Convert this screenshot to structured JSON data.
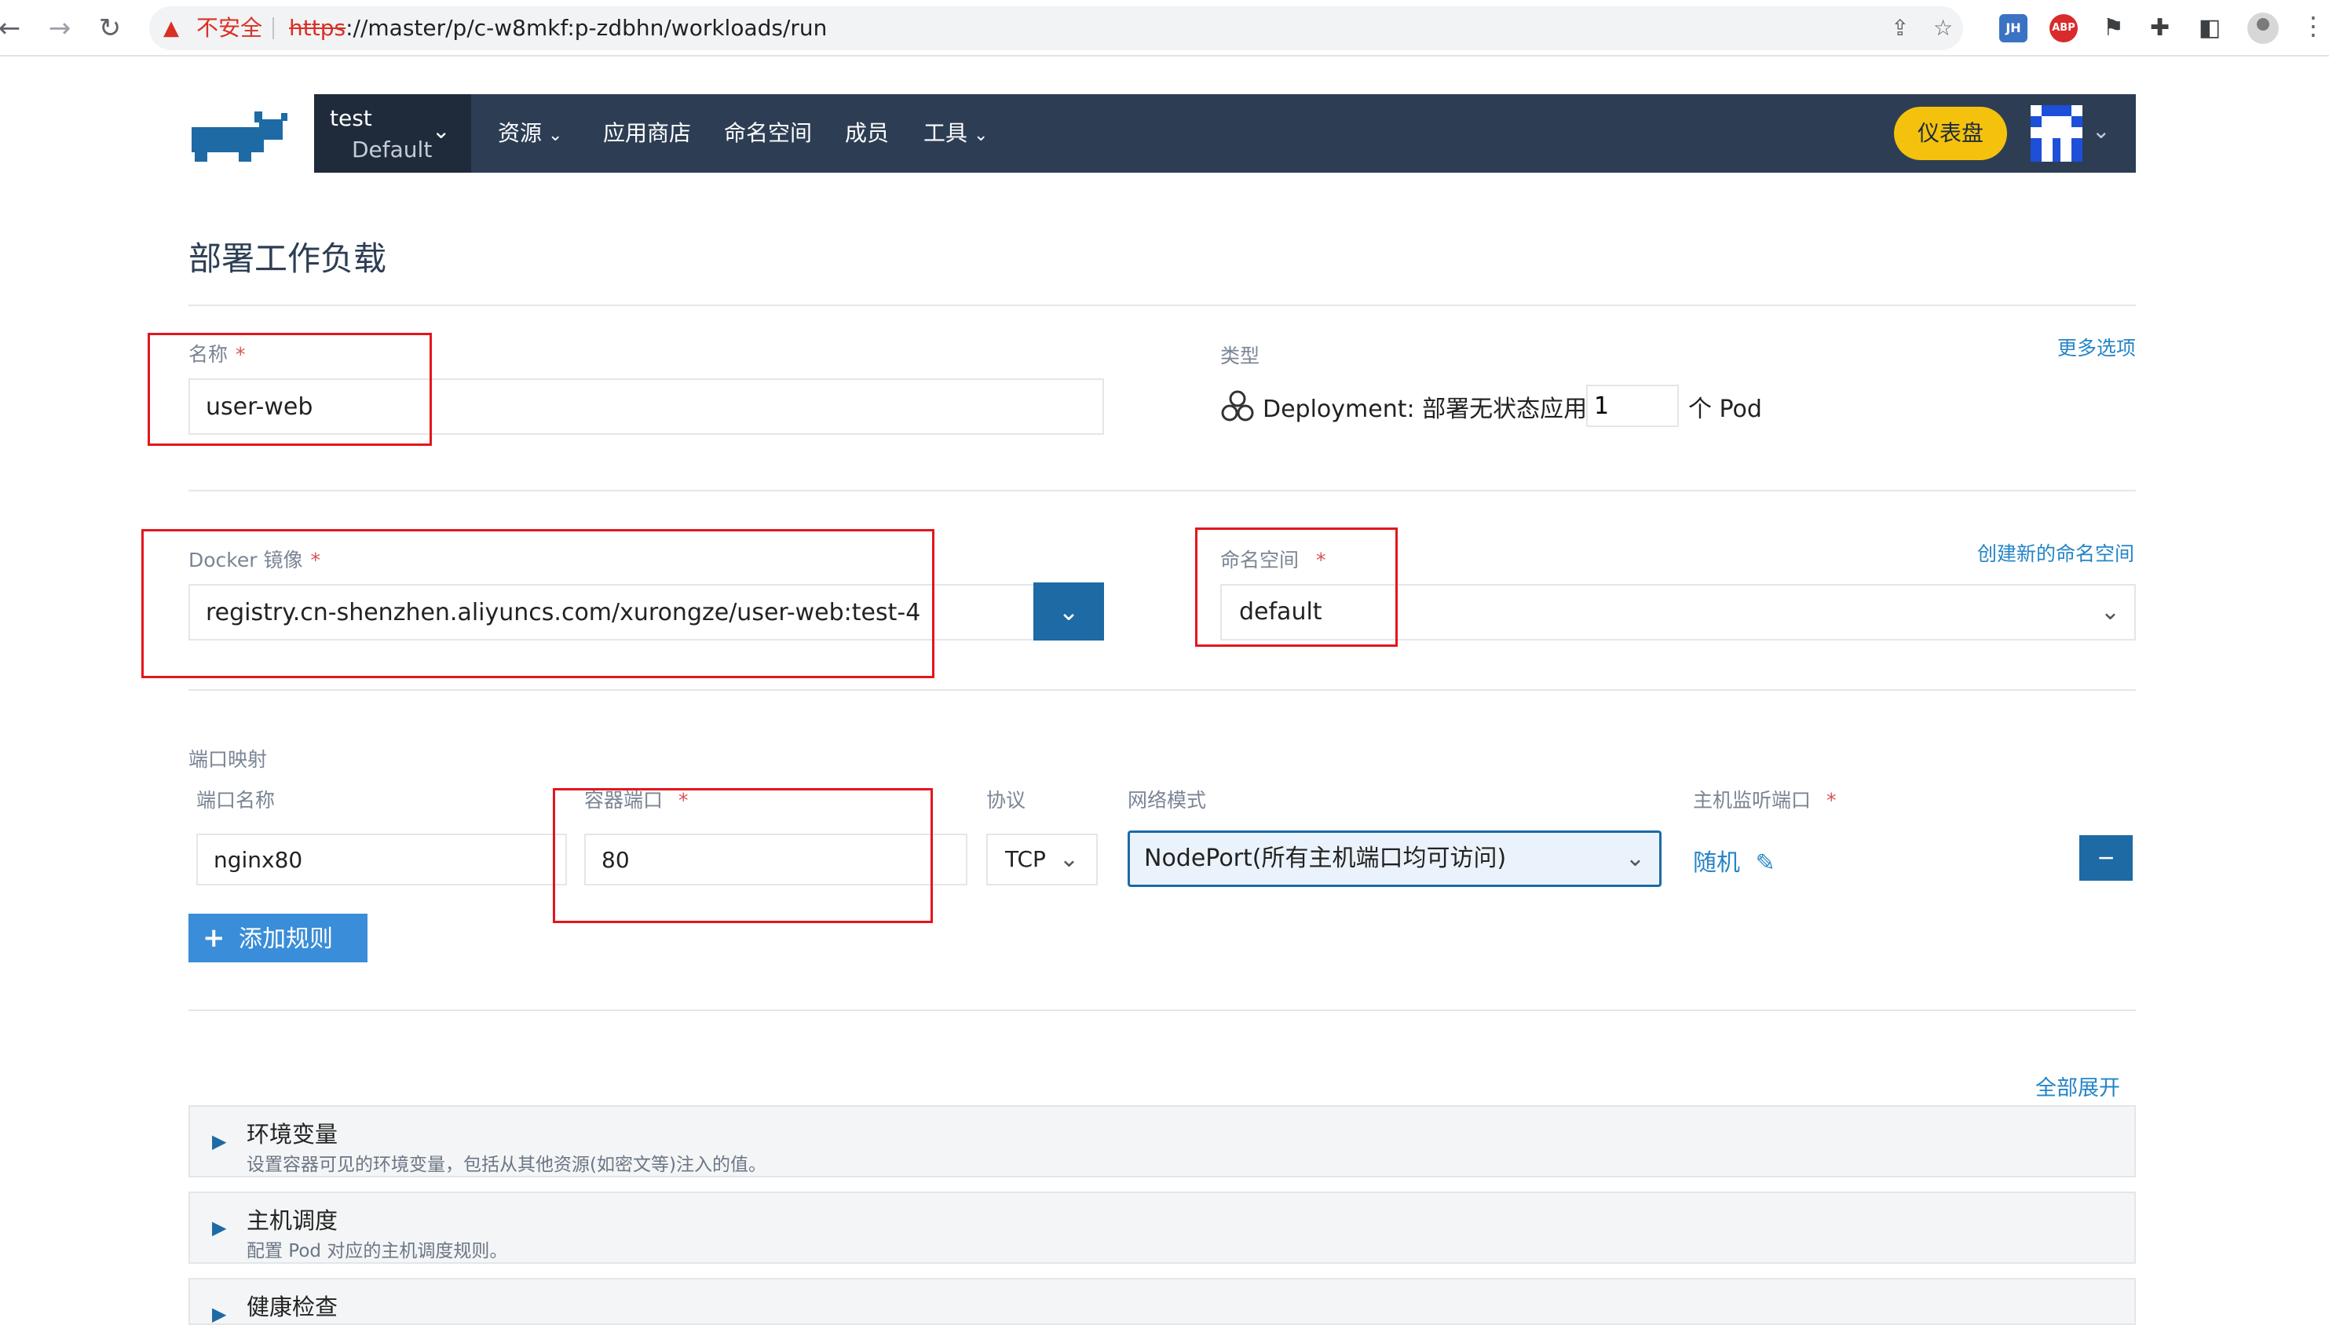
{
  "browser": {
    "insecure_label": "不安全",
    "url_scheme": "https",
    "url_rest": "://master/p/c-w8mkf:p-zdbhn/workloads/run",
    "ext_jh": "JH",
    "ext_abp": "ABP"
  },
  "header": {
    "cluster": "test",
    "project": "Default",
    "nav": {
      "resources": "资源",
      "app_store": "应用商店",
      "namespaces": "命名空间",
      "members": "成员",
      "tools": "工具"
    },
    "dashboard_btn": "仪表盘"
  },
  "page": {
    "title": "部署工作负载"
  },
  "form": {
    "name_label": "名称",
    "required_mark": "*",
    "name_value": "user-web",
    "type_label": "类型",
    "more_options": "更多选项",
    "workload_type": "Deployment: 部署无状态应用",
    "scale": "1",
    "pod_suffix": "个 Pod",
    "image_label": "Docker 镜像",
    "image_value": "registry.cn-shenzhen.aliyuncs.com/xurongze/user-web:test-4",
    "namespace_label": "命名空间",
    "create_namespace": "创建新的命名空间",
    "namespace_value": "default"
  },
  "ports": {
    "section_label": "端口映射",
    "col_name": "端口名称",
    "col_container_port": "容器端口",
    "col_protocol": "协议",
    "col_network_mode": "网络模式",
    "col_host_port": "主机监听端口",
    "rows": [
      {
        "name": "nginx80",
        "container_port": "80",
        "protocol": "TCP",
        "network_mode": "NodePort(所有主机端口均可访问)",
        "host_port": "随机"
      }
    ],
    "add_rule": "添加规则"
  },
  "sections": {
    "expand_all": "全部展开",
    "items": [
      {
        "title": "环境变量",
        "desc": "设置容器可见的环境变量，包括从其他资源(如密文等)注入的值。"
      },
      {
        "title": "主机调度",
        "desc": "配置 Pod 对应的主机调度规则。"
      },
      {
        "title": "健康检查",
        "desc": ""
      }
    ]
  },
  "colors": {
    "header_bg": "#2d3e54",
    "accent_blue": "#1d6aa5",
    "dashboard_yellow": "#f4c20d",
    "annotation_red": "#e3161d"
  }
}
